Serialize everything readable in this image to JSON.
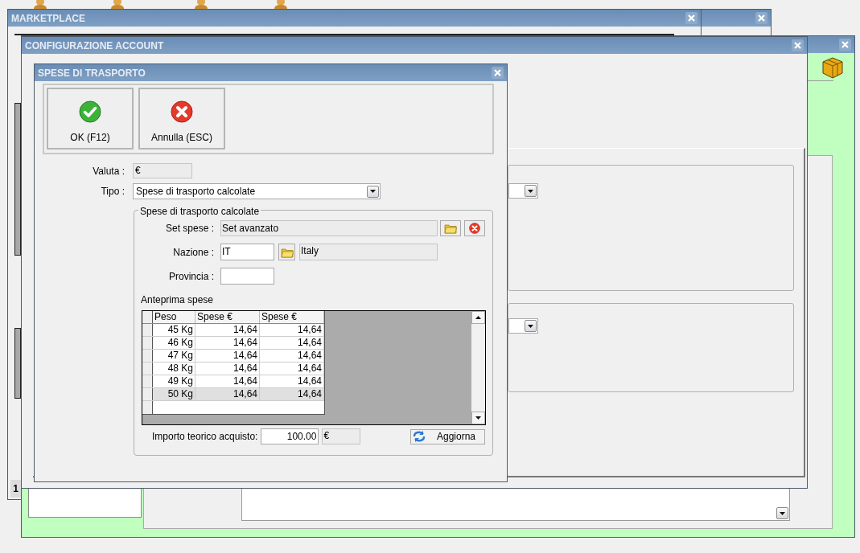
{
  "marketplace_window": {
    "title": "MARKETPLACE",
    "page_tab": "1"
  },
  "account_window": {
    "title": "CONFIGURAZIONE ACCOUNT"
  },
  "dialog": {
    "title": "SPESE DI TRASPORTO",
    "toolbar": [
      {
        "label": "OK (F12)",
        "kind": "ok"
      },
      {
        "label": "Annulla (ESC)",
        "kind": "cancel"
      }
    ],
    "valuta": {
      "label": "Valuta :",
      "value": "€"
    },
    "tipo": {
      "label": "Tipo :",
      "value": "Spese di trasporto calcolate"
    },
    "group": {
      "legend": "Spese di trasporto calcolate",
      "set_spese": {
        "label": "Set spese :",
        "value": "Set avanzato"
      },
      "nazione": {
        "label": "Nazione :",
        "code": "IT",
        "name": "Italy"
      },
      "provincia": {
        "label": "Provincia :"
      },
      "preview_label": "Anteprima spese",
      "table": {
        "columns": [
          "Peso",
          "Spese €",
          "Spese €"
        ],
        "rows": [
          {
            "cells": [
              "45 Kg",
              "14,64",
              "14,64"
            ],
            "selected": false
          },
          {
            "cells": [
              "46 Kg",
              "14,64",
              "14,64"
            ],
            "selected": false
          },
          {
            "cells": [
              "47 Kg",
              "14,64",
              "14,64"
            ],
            "selected": false
          },
          {
            "cells": [
              "48 Kg",
              "14,64",
              "14,64"
            ],
            "selected": false
          },
          {
            "cells": [
              "49 Kg",
              "14,64",
              "14,64"
            ],
            "selected": false
          },
          {
            "cells": [
              "50 Kg",
              "14,64",
              "14,64"
            ],
            "selected": true
          }
        ]
      },
      "importo": {
        "label": "Importo teorico acquisto:",
        "value": "100.00",
        "currency": "€"
      },
      "refresh_button": "Aggiorna"
    }
  }
}
